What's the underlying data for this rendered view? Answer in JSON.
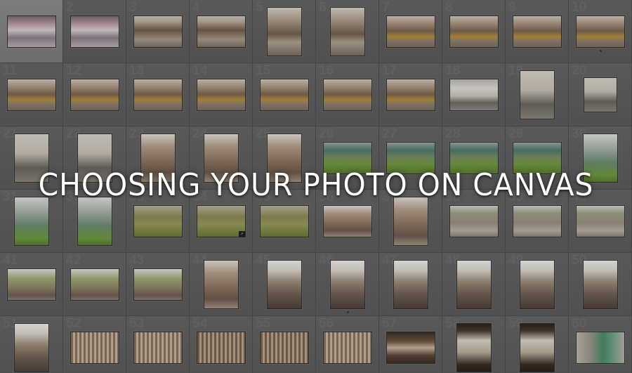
{
  "headline": "CHOOSING YOUR PHOTO ON CANVAS",
  "grid": {
    "columns": 10,
    "rows": 6,
    "selected_index": 0,
    "cells": [
      {
        "num": "",
        "look": "graffiti",
        "orient": "landscape"
      },
      {
        "num": "2",
        "look": "graffiti",
        "orient": "landscape"
      },
      {
        "num": "3",
        "look": "street",
        "orient": "landscape"
      },
      {
        "num": "4",
        "look": "street",
        "orient": "landscape"
      },
      {
        "num": "5",
        "look": "street2",
        "orient": "portrait"
      },
      {
        "num": "6",
        "look": "street2",
        "orient": "portrait"
      },
      {
        "num": "7",
        "look": "taxi",
        "orient": "landscape"
      },
      {
        "num": "8",
        "look": "taxi",
        "orient": "landscape"
      },
      {
        "num": "9",
        "look": "taxi",
        "orient": "landscape"
      },
      {
        "num": "10",
        "look": "taxi",
        "orient": "landscape",
        "dot": true
      },
      {
        "num": "11",
        "look": "taxi",
        "orient": "landscape"
      },
      {
        "num": "12",
        "look": "taxi",
        "orient": "landscape"
      },
      {
        "num": "13",
        "look": "taxi",
        "orient": "landscape"
      },
      {
        "num": "14",
        "look": "taxi",
        "orient": "landscape"
      },
      {
        "num": "15",
        "look": "taxi",
        "orient": "landscape"
      },
      {
        "num": "16",
        "look": "taxi",
        "orient": "landscape"
      },
      {
        "num": "17",
        "look": "taxi",
        "orient": "landscape"
      },
      {
        "num": "18",
        "look": "library",
        "orient": "landscape"
      },
      {
        "num": "19",
        "look": "lib2",
        "orient": "portrait"
      },
      {
        "num": "20",
        "look": "lib2",
        "orient": "square"
      },
      {
        "num": "21",
        "look": "lib2",
        "orient": "portrait"
      },
      {
        "num": "22",
        "look": "lib2",
        "orient": "portrait"
      },
      {
        "num": "23",
        "look": "tower",
        "orient": "portrait"
      },
      {
        "num": "24",
        "look": "tower",
        "orient": "portrait"
      },
      {
        "num": "25",
        "look": "tower",
        "orient": "portrait"
      },
      {
        "num": "26",
        "look": "park",
        "orient": "landscape"
      },
      {
        "num": "27",
        "look": "park",
        "orient": "landscape"
      },
      {
        "num": "28",
        "look": "park",
        "orient": "landscape"
      },
      {
        "num": "29",
        "look": "park",
        "orient": "landscape"
      },
      {
        "num": "30",
        "look": "parkw",
        "orient": "portrait"
      },
      {
        "num": "31",
        "look": "parkw",
        "orient": "portrait"
      },
      {
        "num": "32",
        "look": "parkw",
        "orient": "portrait"
      },
      {
        "num": "33",
        "look": "parkg",
        "orient": "landscape"
      },
      {
        "num": "34",
        "look": "parkg",
        "orient": "landscape",
        "badge": true
      },
      {
        "num": "35",
        "look": "parkg",
        "orient": "landscape"
      },
      {
        "num": "36",
        "look": "tower",
        "orient": "landscape"
      },
      {
        "num": "37",
        "look": "tower",
        "orient": "portrait"
      },
      {
        "num": "38",
        "look": "sidewalk",
        "orient": "landscape"
      },
      {
        "num": "39",
        "look": "sidewalk",
        "orient": "landscape"
      },
      {
        "num": "40",
        "look": "sidewalk",
        "orient": "landscape"
      },
      {
        "num": "41",
        "look": "trees",
        "orient": "landscape"
      },
      {
        "num": "42",
        "look": "trees",
        "orient": "landscape"
      },
      {
        "num": "43",
        "look": "trees",
        "orient": "landscape"
      },
      {
        "num": "44",
        "look": "tower",
        "orient": "portrait"
      },
      {
        "num": "45",
        "look": "empire",
        "orient": "portrait"
      },
      {
        "num": "46",
        "look": "empire",
        "orient": "portrait",
        "dot": true
      },
      {
        "num": "47",
        "look": "empire",
        "orient": "portrait"
      },
      {
        "num": "48",
        "look": "empire",
        "orient": "portrait"
      },
      {
        "num": "49",
        "look": "empire",
        "orient": "portrait"
      },
      {
        "num": "50",
        "look": "empire",
        "orient": "portrait"
      },
      {
        "num": "51",
        "look": "empire",
        "orient": "portrait"
      },
      {
        "num": "52",
        "look": "facade",
        "orient": "landscape"
      },
      {
        "num": "53",
        "look": "facade",
        "orient": "landscape"
      },
      {
        "num": "54",
        "look": "facade2",
        "orient": "landscape"
      },
      {
        "num": "55",
        "look": "facade2",
        "orient": "landscape"
      },
      {
        "num": "56",
        "look": "facade",
        "orient": "landscape"
      },
      {
        "num": "57",
        "look": "interior",
        "orient": "landscape"
      },
      {
        "num": "58",
        "look": "window",
        "orient": "portrait"
      },
      {
        "num": "59",
        "look": "window",
        "orient": "portrait"
      },
      {
        "num": "60",
        "look": "green",
        "orient": "landscape"
      }
    ]
  }
}
